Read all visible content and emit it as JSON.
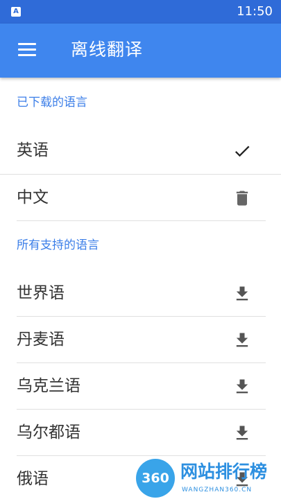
{
  "status_bar": {
    "time": "11:50",
    "app_icon_letter": "A"
  },
  "app_bar": {
    "title": "离线翻译",
    "menu_icon": "hamburger-menu-icon"
  },
  "downloaded_section": {
    "header": "已下载的语言",
    "items": [
      {
        "label": "英语",
        "icon": "check-icon"
      },
      {
        "label": "中文",
        "icon": "delete-icon"
      }
    ]
  },
  "supported_section": {
    "header": "所有支持的语言",
    "items": [
      {
        "label": "世界语",
        "icon": "download-icon"
      },
      {
        "label": "丹麦语",
        "icon": "download-icon"
      },
      {
        "label": "乌克兰语",
        "icon": "download-icon"
      },
      {
        "label": "乌尔都语",
        "icon": "download-icon"
      },
      {
        "label": "俄语",
        "icon": "download-icon"
      }
    ]
  },
  "watermark": {
    "badge": "360",
    "title": "网站排行榜",
    "subtitle": "WANGZHAN360.CN"
  },
  "colors": {
    "status_bar": "#2f6bd8",
    "app_bar": "#3f86ee",
    "section_header": "#3b7ee8"
  }
}
